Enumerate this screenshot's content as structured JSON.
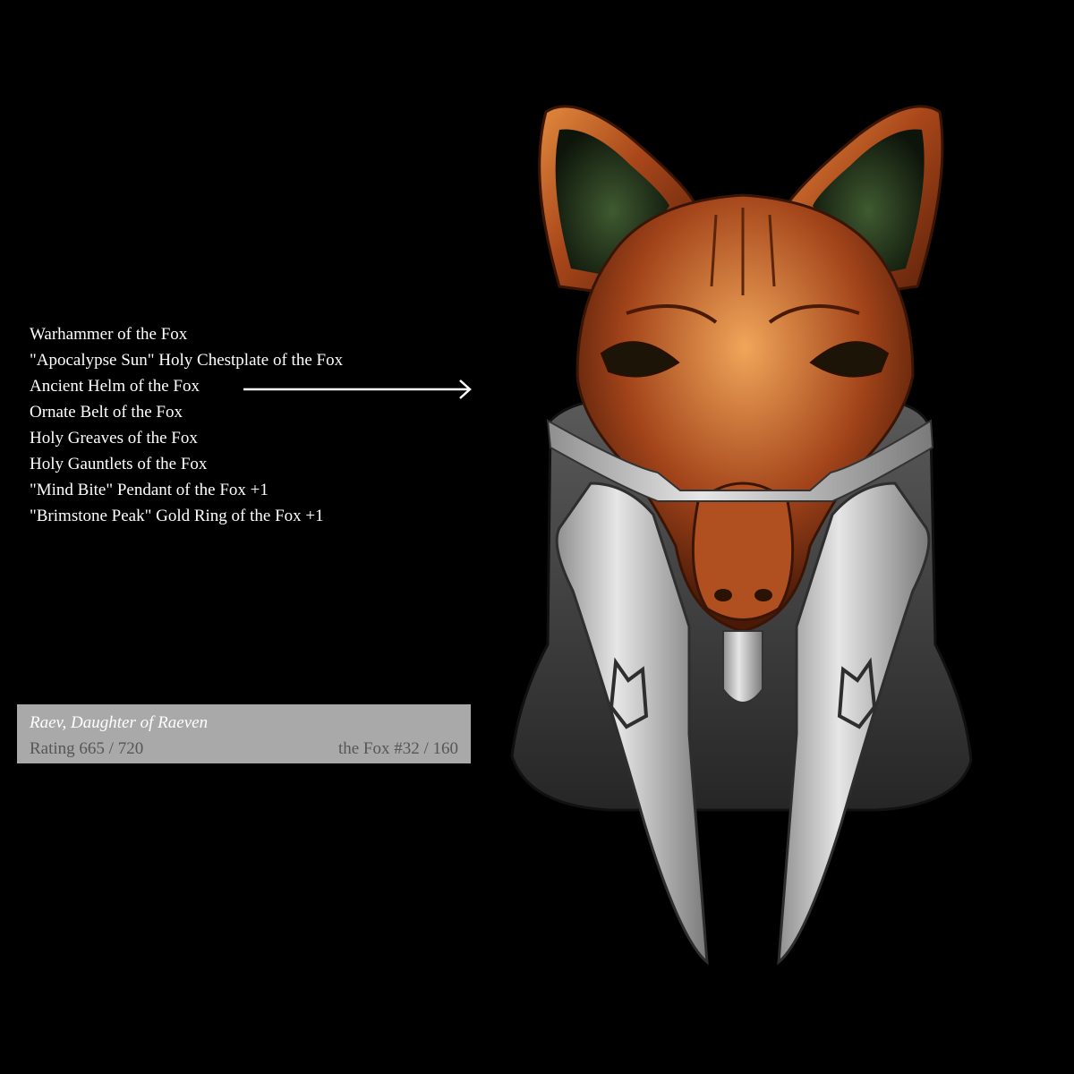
{
  "equipment": {
    "items": [
      "Warhammer of the Fox",
      "\"Apocalypse Sun\" Holy Chestplate of the Fox",
      "Ancient Helm of the Fox",
      "Ornate Belt of the Fox",
      "Holy Greaves of the Fox",
      "Holy Gauntlets of the Fox",
      "\"Mind Bite\" Pendant of the Fox +1",
      "\"Brimstone Peak\" Gold Ring of the Fox +1"
    ],
    "highlighted_item": "Ancient Helm of the Fox",
    "pointer_icon": "right-arrow-icon"
  },
  "character": {
    "name": "Raev, Daughter of Raeven",
    "rating": "Rating 665 / 720",
    "order_rank": "the Fox #32 / 160"
  },
  "artwork": {
    "subject": "fox-helm-icon"
  },
  "colors": {
    "background": "#000000",
    "list_text": "#ffffff",
    "card_background": "#a9a9a9",
    "card_name": "#ffffff",
    "card_meta": "#565656",
    "helm_copper": "#b5561c",
    "helm_silver": "#bdbdbd",
    "helm_dark_metal": "#3b3b3b"
  }
}
